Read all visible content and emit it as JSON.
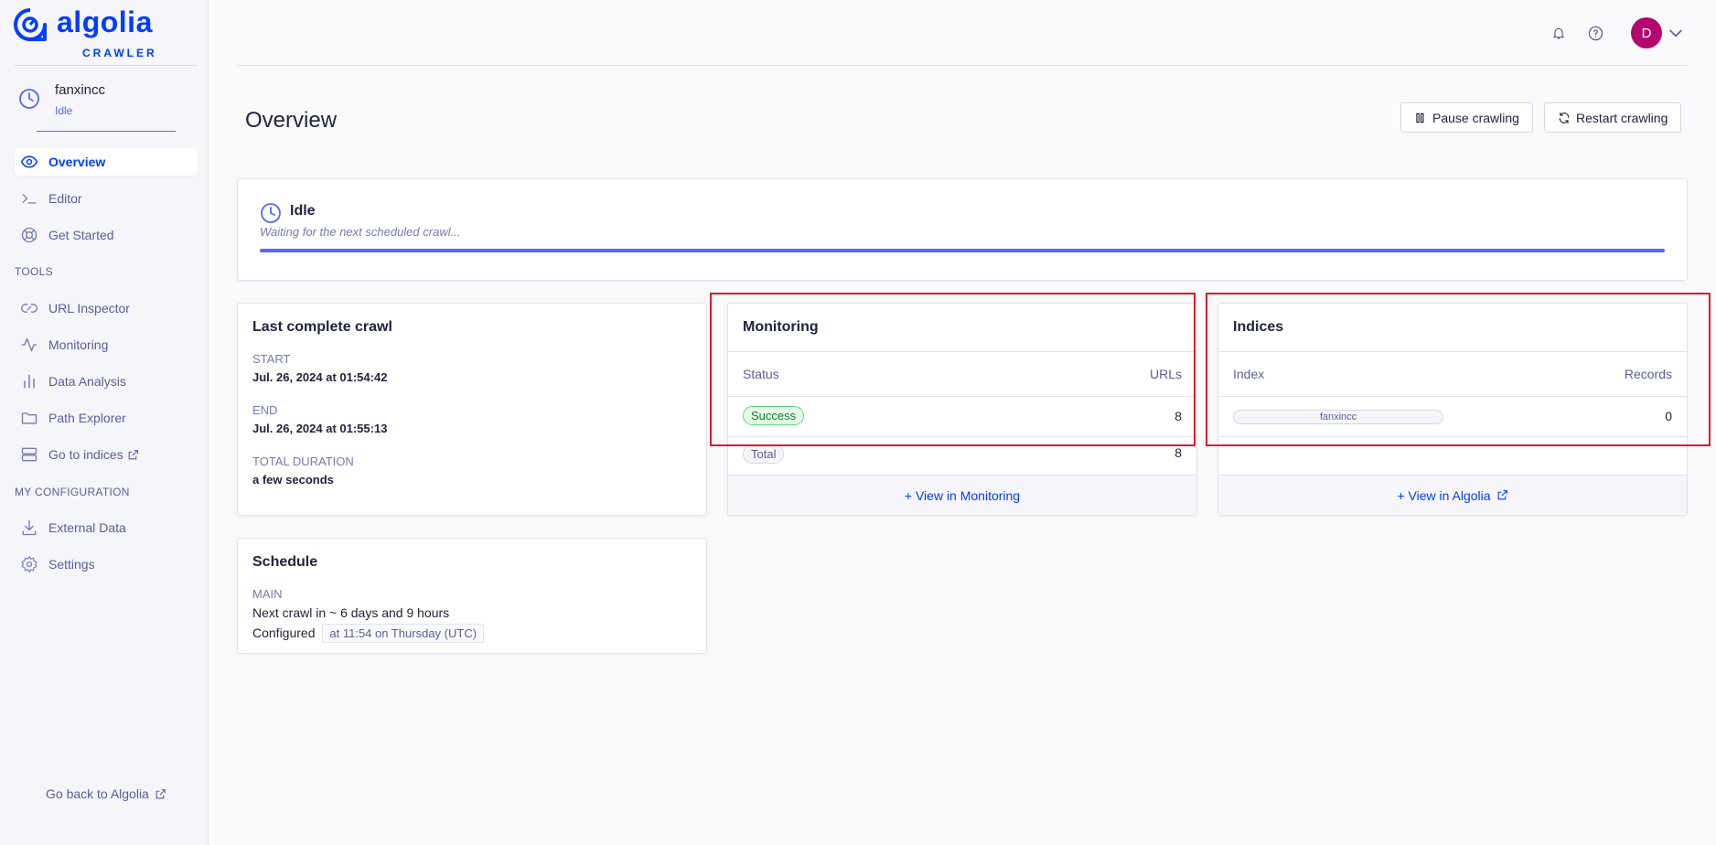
{
  "brand": {
    "name": "algolia",
    "product": "CRAWLER",
    "color": "#003dff"
  },
  "crawler": {
    "name": "fanxincc",
    "state": "Idle"
  },
  "sidebar": {
    "items": [
      {
        "label": "Overview",
        "icon": "eye-icon",
        "active": true
      },
      {
        "label": "Editor",
        "icon": "terminal-icon"
      },
      {
        "label": "Get Started",
        "icon": "lifebuoy-icon"
      }
    ],
    "tools_heading": "TOOLS",
    "tools": [
      {
        "label": "URL Inspector",
        "icon": "link-icon"
      },
      {
        "label": "Monitoring",
        "icon": "activity-icon"
      },
      {
        "label": "Data Analysis",
        "icon": "bar-chart-icon"
      },
      {
        "label": "Path Explorer",
        "icon": "folder-icon"
      },
      {
        "label": "Go to indices",
        "icon": "database-icon"
      }
    ],
    "config_heading": "MY CONFIGURATION",
    "config": [
      {
        "label": "External Data",
        "icon": "download-icon"
      },
      {
        "label": "Settings",
        "icon": "gear-icon"
      }
    ],
    "go_back": "Go back to Algolia"
  },
  "topbar": {
    "avatar_initial": "D",
    "avatar_color": "#b4066f"
  },
  "page": {
    "title": "Overview",
    "pause_label": "Pause crawling",
    "restart_label": "Restart crawling"
  },
  "status": {
    "title": "Idle",
    "subtitle": "Waiting for the next scheduled crawl...",
    "progress": 1.0
  },
  "last_crawl": {
    "title": "Last complete crawl",
    "start_label": "START",
    "start_value": "Jul. 26, 2024 at 01:54:42",
    "end_label": "END",
    "end_value": "Jul. 26, 2024 at 01:55:13",
    "duration_label": "TOTAL DURATION",
    "duration_value": "a few seconds"
  },
  "schedule": {
    "title": "Schedule",
    "label": "MAIN",
    "next": "Next crawl in ~ 6 days and 9 hours",
    "configured_label": "Configured",
    "configured_value": "at 11:54 on Thursday (UTC)"
  },
  "monitoring": {
    "title": "Monitoring",
    "col_status": "Status",
    "col_urls": "URLs",
    "rows": [
      {
        "status": "Success",
        "urls": "8"
      },
      {
        "status": "Total",
        "urls": "8"
      }
    ],
    "footer": "+ View in Monitoring"
  },
  "indices": {
    "title": "Indices",
    "col_index": "Index",
    "col_records": "Records",
    "rows": [
      {
        "index": "fanxincc",
        "records": "0"
      }
    ],
    "footer": "+ View in Algolia"
  }
}
